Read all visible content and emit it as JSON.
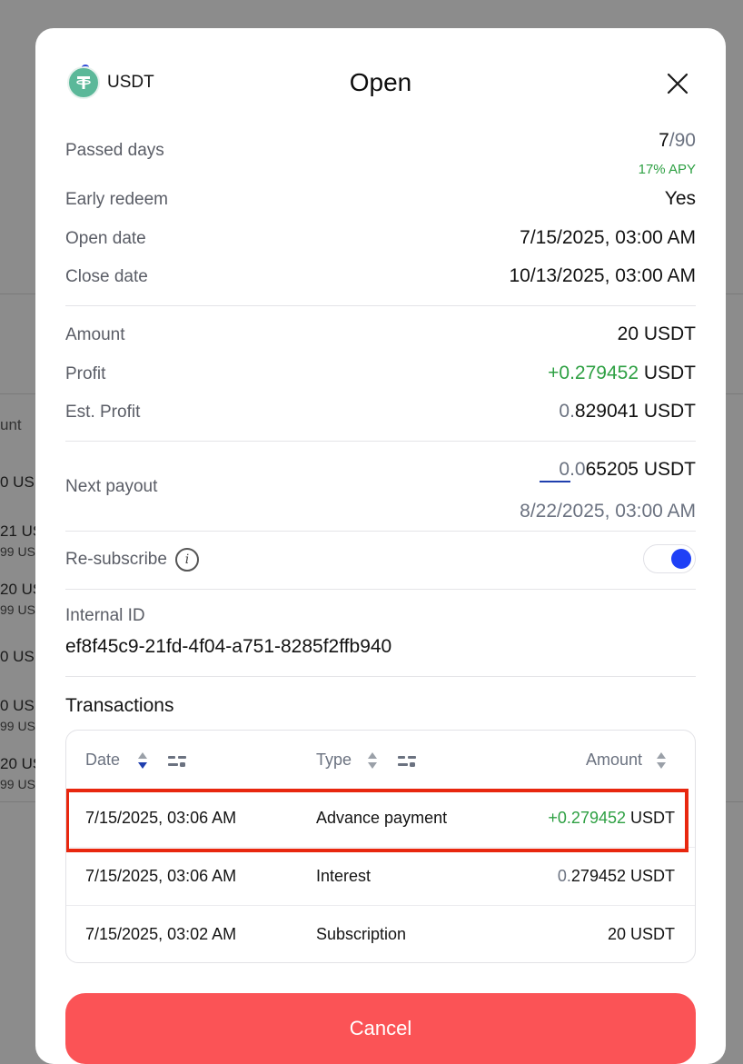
{
  "background": {
    "col_header": "unt",
    "rows": [
      {
        "main": "0 US",
        "sub": ""
      },
      {
        "main": "21 US",
        "sub": "99 US"
      },
      {
        "main": "20 US",
        "sub": "99 US"
      },
      {
        "main": "0 US",
        "sub": ""
      },
      {
        "main": "0 USI",
        "sub": "99 US"
      },
      {
        "main": "20 US",
        "sub": "99 US"
      }
    ]
  },
  "modal": {
    "coin": "USDT",
    "title": "Open",
    "details": {
      "passed_days_label": "Passed days",
      "passed_days_current": "7",
      "passed_days_total": "/90",
      "apy": "17% APY",
      "early_redeem_label": "Early redeem",
      "early_redeem_value": "Yes",
      "open_date_label": "Open date",
      "open_date_value": "7/15/2025, 03:00 AM",
      "close_date_label": "Close date",
      "close_date_value": "10/13/2025, 03:00 AM"
    },
    "amounts": {
      "amount_label": "Amount",
      "amount_value": "20 USDT",
      "profit_label": "Profit",
      "profit_value": "+0.279452",
      "profit_unit": " USDT",
      "est_profit_label": "Est. Profit",
      "est_profit_prefix": "0.",
      "est_profit_rest": "829041 USDT"
    },
    "next_payout": {
      "label": "Next payout",
      "prefix": "0.0",
      "rest": "65205 USDT",
      "date": "8/22/2025, 03:00 AM"
    },
    "resubscribe": {
      "label": "Re-subscribe",
      "info_glyph": "i",
      "enabled": true
    },
    "internal_id": {
      "label": "Internal ID",
      "value": "ef8f45c9-21fd-4f04-a751-8285f2ffb940"
    },
    "transactions": {
      "title": "Transactions",
      "headers": {
        "date": "Date",
        "type": "Type",
        "amount": "Amount"
      },
      "rows": [
        {
          "date": "7/15/2025, 03:06 AM",
          "type": "Advance payment",
          "amount_prefix": "",
          "amount_main": "+0.279452",
          "unit": " USDT",
          "positive": true
        },
        {
          "date": "7/15/2025, 03:06 AM",
          "type": "Interest",
          "amount_prefix": "0.",
          "amount_main": "279452",
          "unit": " USDT",
          "positive": false
        },
        {
          "date": "7/15/2025, 03:02 AM",
          "type": "Subscription",
          "amount_prefix": "",
          "amount_main": "20",
          "unit": " USDT",
          "positive": false
        }
      ]
    },
    "cancel_label": "Cancel"
  },
  "colors": {
    "accent_green": "#2ea043",
    "toggle_blue": "#1f40f6",
    "cancel_red": "#fb5356",
    "highlight_red": "#e8270f"
  }
}
